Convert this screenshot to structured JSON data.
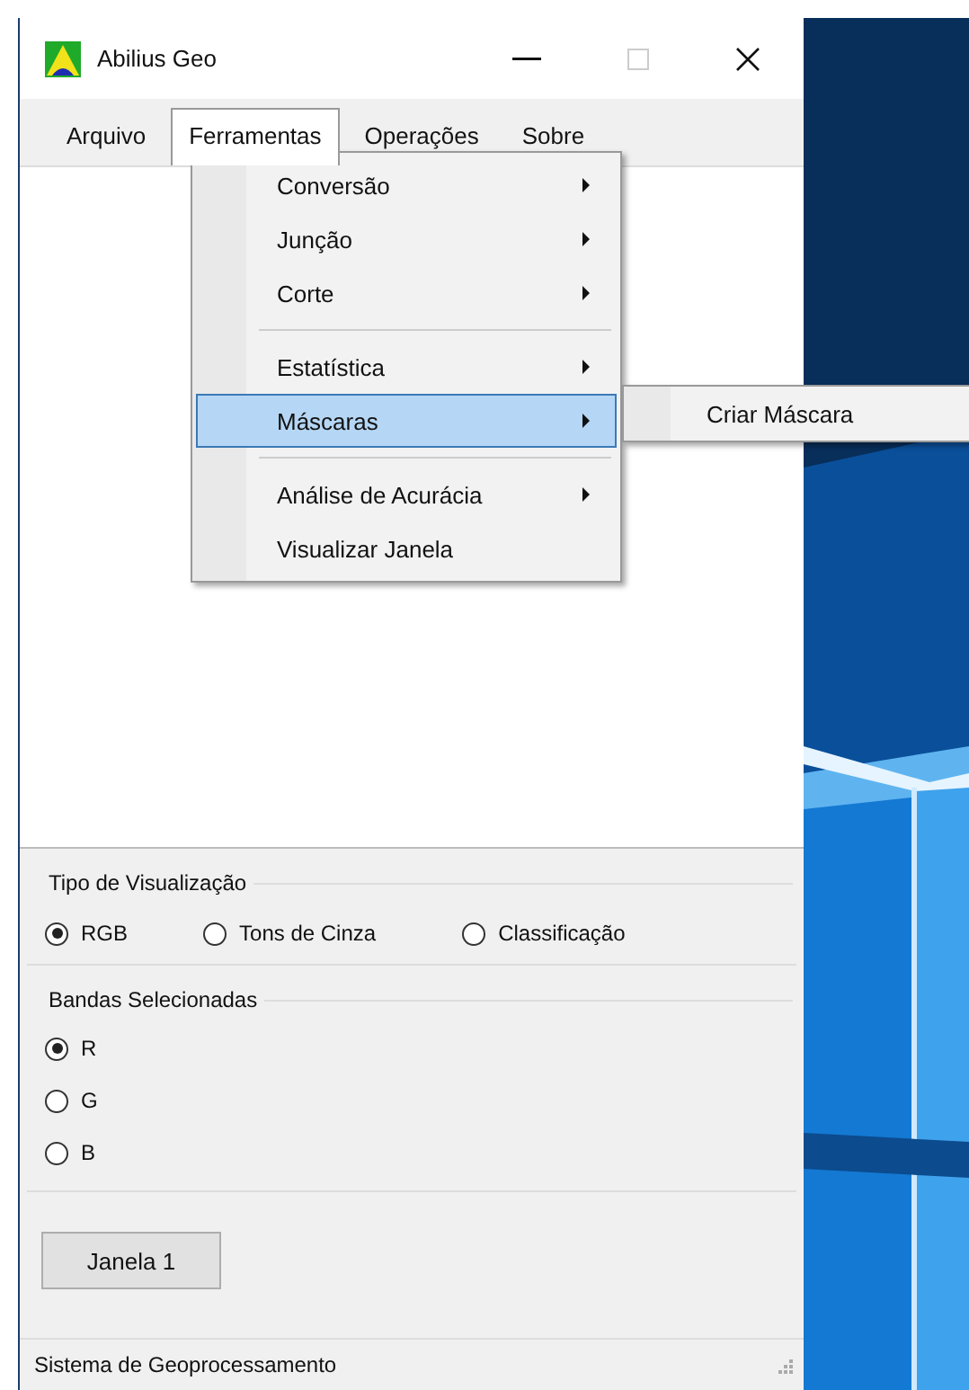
{
  "window": {
    "title": "Abilius Geo"
  },
  "menu_bar": [
    {
      "label": "Arquivo",
      "selected": false
    },
    {
      "label": "Ferramentas",
      "selected": true
    },
    {
      "label": "Operações",
      "selected": false
    },
    {
      "label": "Sobre",
      "selected": false
    }
  ],
  "dropdown": [
    {
      "label": "Conversão",
      "submenu": true,
      "separator_before": false,
      "selected": false
    },
    {
      "label": "Junção",
      "submenu": true,
      "separator_before": false,
      "selected": false
    },
    {
      "label": "Corte",
      "submenu": true,
      "separator_before": false,
      "selected": false
    },
    {
      "label": "Estatística",
      "submenu": true,
      "separator_before": true,
      "selected": false
    },
    {
      "label": "Máscaras",
      "submenu": true,
      "separator_before": false,
      "selected": true
    },
    {
      "label": "Análise de Acurácia",
      "submenu": true,
      "separator_before": true,
      "selected": false
    },
    {
      "label": "Visualizar Janela",
      "submenu": false,
      "separator_before": false,
      "selected": false
    }
  ],
  "submenu": [
    {
      "label": "Criar Máscara",
      "selected": false
    }
  ],
  "visualization": {
    "title": "Tipo de Visualização",
    "options": [
      {
        "label": "RGB",
        "selected": true
      },
      {
        "label": "Tons de Cinza",
        "selected": false
      },
      {
        "label": "Classificação",
        "selected": false
      }
    ]
  },
  "bands": {
    "title": "Bandas Selecionadas",
    "options": [
      {
        "label": "R",
        "selected": true
      },
      {
        "label": "G",
        "selected": false
      },
      {
        "label": "B",
        "selected": false
      }
    ]
  },
  "button": "Janela 1",
  "status_bar": "Sistema de Geoprocessamento"
}
